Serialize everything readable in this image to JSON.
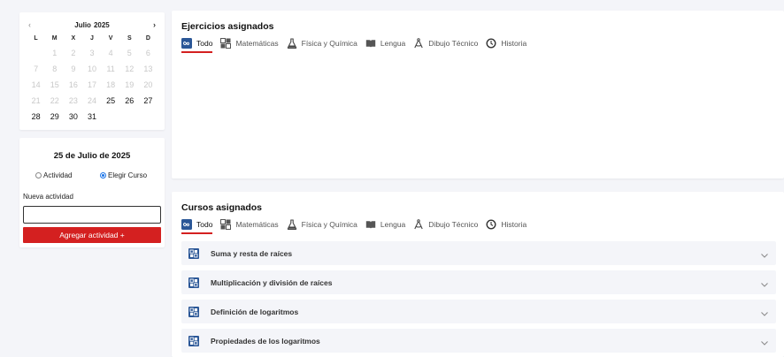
{
  "calendar": {
    "prev_icon": "chevron-left-icon",
    "next_icon": "chevron-right-icon",
    "month": "Julio",
    "year": "2025",
    "weekdays": [
      "L",
      "M",
      "X",
      "J",
      "V",
      "S",
      "D"
    ],
    "weeks": [
      [
        {
          "d": "1",
          "active": false
        },
        {
          "d": "2",
          "active": false
        },
        {
          "d": "3",
          "active": false
        },
        {
          "d": "4",
          "active": false
        },
        {
          "d": "5",
          "active": false
        },
        {
          "d": "6",
          "active": false
        }
      ],
      [
        {
          "d": "7",
          "active": false
        },
        {
          "d": "8",
          "active": false
        },
        {
          "d": "9",
          "active": false
        },
        {
          "d": "10",
          "active": false
        },
        {
          "d": "11",
          "active": false
        },
        {
          "d": "12",
          "active": false
        },
        {
          "d": "13",
          "active": false
        }
      ],
      [
        {
          "d": "14",
          "active": false
        },
        {
          "d": "15",
          "active": false
        },
        {
          "d": "16",
          "active": false
        },
        {
          "d": "17",
          "active": false
        },
        {
          "d": "18",
          "active": false
        },
        {
          "d": "19",
          "active": false
        },
        {
          "d": "20",
          "active": false
        }
      ],
      [
        {
          "d": "21",
          "active": false
        },
        {
          "d": "22",
          "active": false
        },
        {
          "d": "23",
          "active": false
        },
        {
          "d": "24",
          "active": false
        },
        {
          "d": "25",
          "active": true
        },
        {
          "d": "26",
          "active": true
        },
        {
          "d": "27",
          "active": true
        }
      ],
      [
        {
          "d": "28",
          "active": true
        },
        {
          "d": "29",
          "active": true
        },
        {
          "d": "30",
          "active": true
        },
        {
          "d": "31",
          "active": true
        }
      ]
    ]
  },
  "activity": {
    "date": "25 de Julio de 2025",
    "radio_activity": "Actividad",
    "radio_course": "Elegir Curso",
    "selected": "Elegir Curso",
    "new_label": "Nueva actividad",
    "input_value": "",
    "add_button": "Agregar actividad +"
  },
  "exercises": {
    "title": "Ejercicios asignados",
    "tabs": [
      {
        "label": "Todo",
        "icon": "infinity-icon",
        "active": true
      },
      {
        "label": "Matemáticas",
        "icon": "grid-icon",
        "active": false
      },
      {
        "label": "Física y Química",
        "icon": "flask-icon",
        "active": false
      },
      {
        "label": "Lengua",
        "icon": "book-icon",
        "active": false
      },
      {
        "label": "Dibujo Técnico",
        "icon": "compass-icon",
        "active": false
      },
      {
        "label": "Historia",
        "icon": "history-icon",
        "active": false
      }
    ]
  },
  "courses": {
    "title": "Cursos asignados",
    "tabs": [
      {
        "label": "Todo",
        "icon": "infinity-icon",
        "active": true
      },
      {
        "label": "Matemáticas",
        "icon": "grid-icon",
        "active": false
      },
      {
        "label": "Física y Química",
        "icon": "flask-icon",
        "active": false
      },
      {
        "label": "Lengua",
        "icon": "book-icon",
        "active": false
      },
      {
        "label": "Dibujo Técnico",
        "icon": "compass-icon",
        "active": false
      },
      {
        "label": "Historia",
        "icon": "history-icon",
        "active": false
      }
    ],
    "items": [
      {
        "label": "Suma y resta de raíces",
        "icon": "grid-icon"
      },
      {
        "label": "Multiplicación y división de raíces",
        "icon": "grid-icon"
      },
      {
        "label": "Definición de logaritmos",
        "icon": "grid-icon"
      },
      {
        "label": "Propiedades de los logaritmos",
        "icon": "grid-icon"
      }
    ]
  },
  "colors": {
    "accent": "#d42020",
    "icon_blue": "#2b5797",
    "background": "#f4f5f9"
  }
}
